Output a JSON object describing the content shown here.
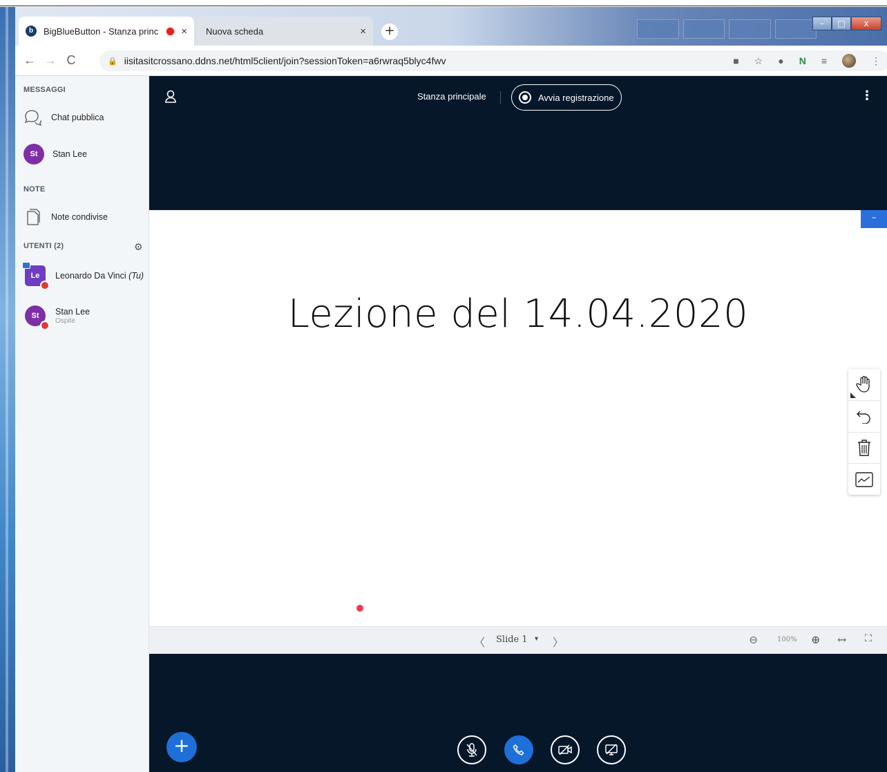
{
  "browser": {
    "tabs": [
      {
        "title": "BigBlueButton - Stanza princ",
        "favicon": "b",
        "recording": true,
        "close": "×"
      },
      {
        "title": "Nuova scheda",
        "close": "×"
      }
    ],
    "new_tab": "+",
    "url": "iisitasitcrossano.ddns.net/html5client/join?sessionToken=a6rwraq5blyc4fwv",
    "window_controls": [
      "–",
      "□",
      "x"
    ]
  },
  "sidebar": {
    "messages_title": "MESSAGGI",
    "public_chat": "Chat pubblica",
    "private_chat": {
      "initials": "St",
      "name": "Stan Lee"
    },
    "notes_title": "NOTE",
    "shared_notes": "Note condivise",
    "users_title": "UTENTI (2)",
    "users": [
      {
        "initials": "Le",
        "name": "Leonardo Da Vinci",
        "suffix": "(Tu)",
        "role": ""
      },
      {
        "initials": "St",
        "name": "Stan Lee",
        "role": "Ospite"
      }
    ]
  },
  "main": {
    "room_title": "Stanza principale",
    "record_label": "Avvia registrazione",
    "slide_title": "Lezione del 14.04.2020",
    "minimize_label": "–",
    "slide_nav": {
      "label": "Slide 1",
      "caret": "▾",
      "prev": "〈",
      "next": "〉"
    },
    "zoom": {
      "value": "100%",
      "out": "⊖",
      "in": "⊕",
      "fit": "↔",
      "fullscreen": "⛶"
    },
    "actions_label": "+"
  },
  "colors": {
    "main_bg": "#06172a",
    "accent": "#1f6fd8",
    "avatar": "#7e2fa6",
    "recording": "#e0241b"
  }
}
